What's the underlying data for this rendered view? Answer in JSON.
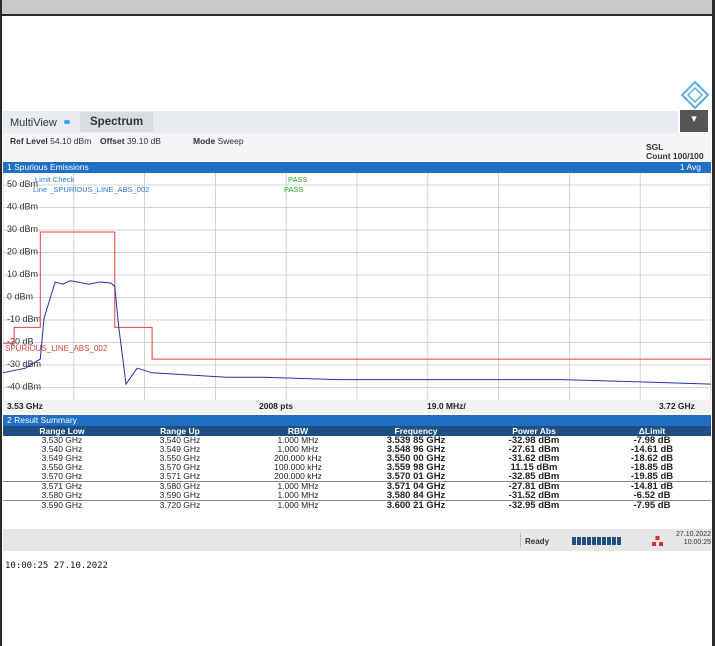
{
  "tabs": {
    "multiview": "MultiView",
    "spectrum": "Spectrum"
  },
  "menu_icon": "hamburger-menu-icon",
  "info": {
    "ref_level_label": "Ref Level",
    "ref_level_value": "54.10 dBm",
    "offset_label": "Offset",
    "offset_value": "39.10 dB",
    "mode_label": "Mode",
    "mode_value": "Sweep",
    "sgl": "SGL",
    "count": "Count 100/100"
  },
  "panel": {
    "title": "1 Spurious Emissions",
    "avg": "1 Avg"
  },
  "limit_check": {
    "title": "Limit Check",
    "line": "Line _SPURIOUS_LINE_ABS_002",
    "result1": "PASS",
    "result2": "PASS"
  },
  "limit_line_label": "SPURIOUS_LINE_ABS_002",
  "x_axis": {
    "start": "3.53 GHz",
    "points": "2008 pts",
    "span": "19.0 MHz/",
    "stop": "3.72 GHz"
  },
  "y_ticks": [
    "50 dBm",
    "40 dBm",
    "30 dBm",
    "20 dBm",
    "10 dBm",
    "0 dBm",
    "-10 dBm",
    "-20 dB",
    "-30 dBm",
    "-40 dBm"
  ],
  "chart_data": {
    "type": "line",
    "x_unit": "GHz",
    "y_unit": "dBm",
    "xlim": [
      3.53,
      3.72
    ],
    "ylim": [
      -45,
      55
    ],
    "trace": {
      "x": [
        3.53,
        3.536,
        3.54,
        3.541,
        3.544,
        3.546,
        3.548,
        3.55,
        3.553,
        3.556,
        3.559,
        3.56,
        3.561,
        3.563,
        3.566,
        3.57,
        3.58,
        3.59,
        3.6,
        3.62,
        3.65,
        3.68,
        3.7,
        3.72
      ],
      "y": [
        -33,
        -31,
        -27,
        -9,
        7,
        6,
        7.5,
        7,
        6,
        7,
        6.5,
        5,
        -12,
        -38,
        -31,
        -33,
        -34,
        -35,
        -35,
        -36,
        -36,
        -36,
        -37,
        -38
      ]
    },
    "limit_line": {
      "x": [
        3.53,
        3.533,
        3.533,
        3.54,
        3.54,
        3.55,
        3.55,
        3.56,
        3.56,
        3.57,
        3.57,
        3.72
      ],
      "y": [
        -20,
        -20,
        -13,
        -13,
        29,
        29,
        29,
        29,
        -13,
        -13,
        -27,
        -27
      ]
    }
  },
  "result_summary": {
    "title": "2 Result Summary",
    "headers": [
      "Range Low",
      "Range Up",
      "RBW",
      "Frequency",
      "Power Abs",
      "ΔLimit"
    ],
    "rows": [
      [
        "3.530 GHz",
        "3.540 GHz",
        "1.000 MHz",
        "3.539 85 GHz",
        "-32.98 dBm",
        "-7.98 dB"
      ],
      [
        "3.540 GHz",
        "3.549 GHz",
        "1.000 MHz",
        "3.548 96 GHz",
        "-27.61 dBm",
        "-14.61 dB"
      ],
      [
        "3.549 GHz",
        "3.550 GHz",
        "200.000 kHz",
        "3.550 00 GHz",
        "-31.62 dBm",
        "-18.62 dB"
      ],
      [
        "3.550 GHz",
        "3.570 GHz",
        "100.000 kHz",
        "3.559 98 GHz",
        "11.15 dBm",
        "-18.85 dB"
      ],
      [
        "3.570 GHz",
        "3.571 GHz",
        "200.000 kHz",
        "3.570 01 GHz",
        "-32.85 dBm",
        "-19.85 dB"
      ],
      [
        "3.571 GHz",
        "3.580 GHz",
        "1.000 MHz",
        "3.571 04 GHz",
        "-27.81 dBm",
        "-14.81 dB"
      ],
      [
        "3.580 GHz",
        "3.590 GHz",
        "1.000 MHz",
        "3.580 84 GHz",
        "-31.52 dBm",
        "-6.52 dB"
      ],
      [
        "3.590 GHz",
        "3.720 GHz",
        "1.000 MHz",
        "3.600 21 GHz",
        "-32.95 dBm",
        "-7.95 dB"
      ]
    ]
  },
  "status": {
    "ready": "Ready",
    "date": "27.10.2022",
    "time": "10:00:25"
  },
  "timestamp": "10:00:25  27.10.2022",
  "colors": {
    "panel_blue": "#1f6fc4",
    "trace_blue": "#2233aa",
    "limit_red": "#e04040",
    "pass_green": "#22aa22"
  }
}
